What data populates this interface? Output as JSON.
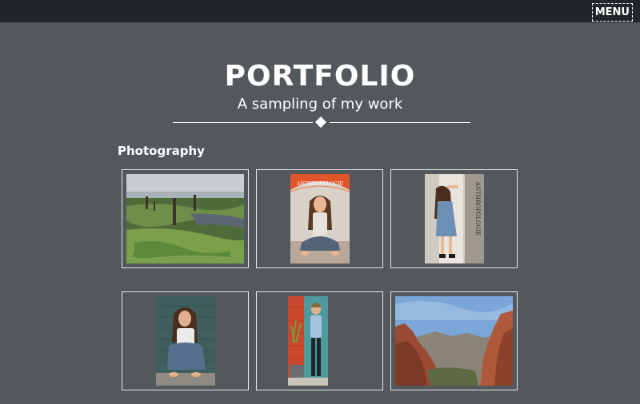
{
  "topbar": {
    "menu_label": "MENU"
  },
  "header": {
    "title": "PORTFOLIO",
    "subtitle": "A sampling of my work"
  },
  "section": {
    "heading": "Photography"
  },
  "gallery": {
    "items": [
      {
        "subject": "marsh-landscape"
      },
      {
        "subject": "girl-under-umbrella",
        "sign_text": "ANTHROPOLOGIE"
      },
      {
        "subject": "girl-at-doorway",
        "sign_text": "ANTHROPOLOGIE"
      },
      {
        "subject": "girl-crouching"
      },
      {
        "subject": "boy-by-wall"
      },
      {
        "subject": "canyon-landscape"
      }
    ]
  },
  "colors": {
    "background": "#53585d",
    "topbar": "#212528",
    "text": "#ffffff",
    "tile_border": "#e8e8e8"
  }
}
